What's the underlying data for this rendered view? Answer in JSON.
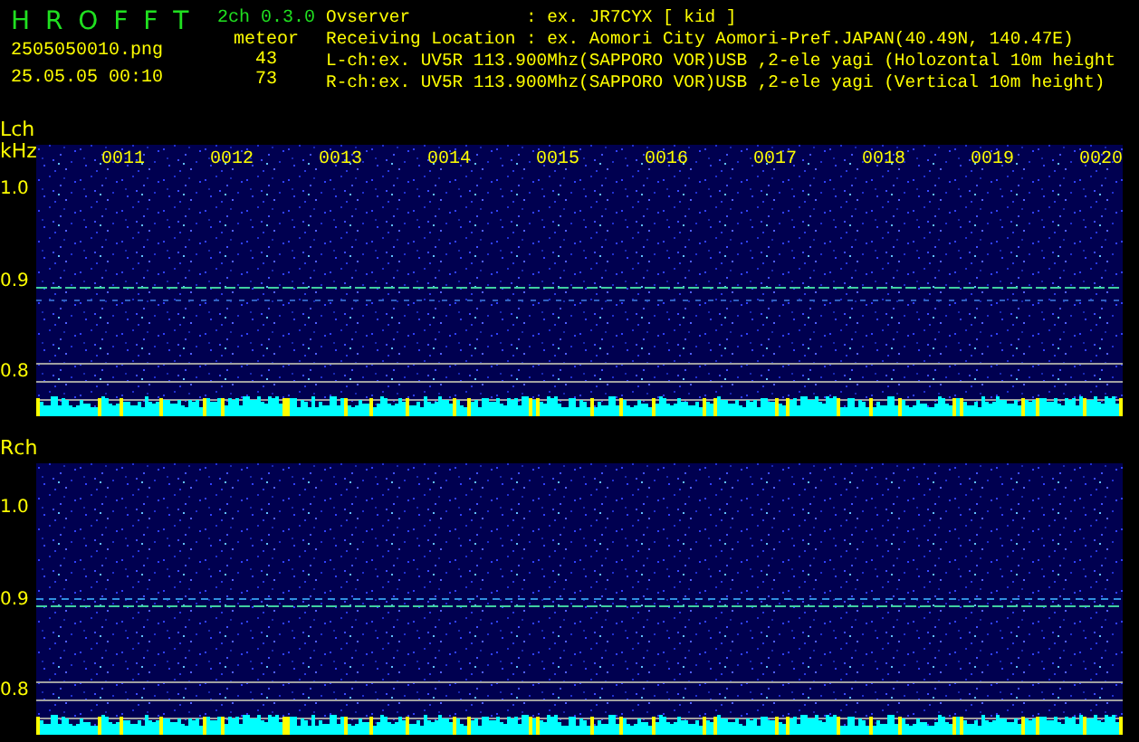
{
  "app": {
    "title": "H R O F F T",
    "version": "2ch 0.3.0",
    "file": "2505050010.png",
    "datetime": "25.05.05 00:10",
    "meteor_label": "meteor",
    "counts": [
      "43",
      "73"
    ]
  },
  "info": [
    "Ovserver           : ex. JR7CYX [ kid ]",
    "Receiving Location : ex. Aomori City Aomori-Pref.JAPAN(40.49N, 140.47E)",
    "L-ch:ex. UV5R 113.900Mhz(SAPPORO VOR)USB ,2-ele yagi (Holozontal 10m height",
    "R-ch:ex. UV5R 113.900Mhz(SAPPORO VOR)USB ,2-ele yagi (Vertical 10m height)"
  ],
  "time_labels": [
    "0011",
    "0012",
    "0013",
    "0014",
    "0015",
    "0016",
    "0017",
    "0018",
    "0019",
    "0020"
  ],
  "channels": [
    {
      "label": "Lch",
      "unit": "kHz",
      "yticks": [
        "1.0",
        "0.9",
        "0.8"
      ]
    },
    {
      "label": "Rch",
      "yticks": [
        "1.0",
        "0.9",
        "0.8"
      ]
    }
  ]
}
